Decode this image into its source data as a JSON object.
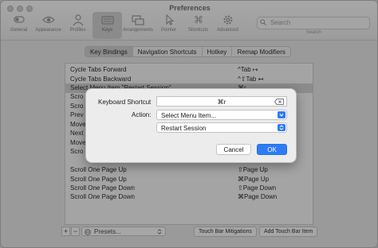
{
  "window": {
    "title": "Preferences"
  },
  "toolbar": {
    "tabs": [
      {
        "label": "General",
        "icon": "switch-icon"
      },
      {
        "label": "Appearance",
        "icon": "eye-icon"
      },
      {
        "label": "Profiles",
        "icon": "person-icon"
      },
      {
        "label": "Keys",
        "icon": "keyboard-icon",
        "active": true
      },
      {
        "label": "Arrangements",
        "icon": "arrangements-icon"
      },
      {
        "label": "Pointer",
        "icon": "pointer-icon"
      },
      {
        "label": "Shortcuts",
        "icon": "command-icon"
      },
      {
        "label": "Advanced",
        "icon": "gear-icon"
      }
    ],
    "search_placeholder": "Search",
    "search_caption": "Search"
  },
  "segments": [
    "Key Bindings",
    "Navigation Shortcuts",
    "Hotkey",
    "Remap Modifiers"
  ],
  "selected_segment": "Key Bindings",
  "bindings": [
    {
      "name": "Cycle Tabs Forward",
      "key": "^Tab ↦"
    },
    {
      "name": "Cycle Tabs Backward",
      "key": "^⇧Tab ↤"
    },
    {
      "name": "Select Menu Item \"Restart Session\"",
      "key": "⌘r",
      "highlight": true
    },
    {
      "name": "Scro",
      "key": ""
    },
    {
      "name": "Scro",
      "key": ""
    },
    {
      "name": "Prev",
      "key": ""
    },
    {
      "name": "Move",
      "key": ""
    },
    {
      "name": "Next",
      "key": ""
    },
    {
      "name": "Move",
      "key": ""
    },
    {
      "name": "Scro",
      "key": ""
    },
    {
      "name": "Scroll One Page Up",
      "key": "⇧Page Up"
    },
    {
      "name": "Scroll One Page Up",
      "key": "⌘Page Up"
    },
    {
      "name": "Scroll One Page Down",
      "key": "⇧Page Down"
    },
    {
      "name": "Scroll One Page Down",
      "key": "⌘Page Down"
    }
  ],
  "bottom": {
    "add": "+",
    "remove": "−",
    "presets": "Presets...",
    "touch_bar_mitigations": "Touch Bar Mitigations",
    "add_touch_bar_item": "Add Touch Bar Item"
  },
  "dialog": {
    "shortcut_label": "Keyboard Shortcut",
    "shortcut_value": "⌘r",
    "action_label": "Action:",
    "action_value": "Select Menu Item...",
    "menu_item_value": "Restart Session",
    "cancel": "Cancel",
    "ok": "OK"
  },
  "colors": {
    "accent": "#2d7cf6"
  }
}
